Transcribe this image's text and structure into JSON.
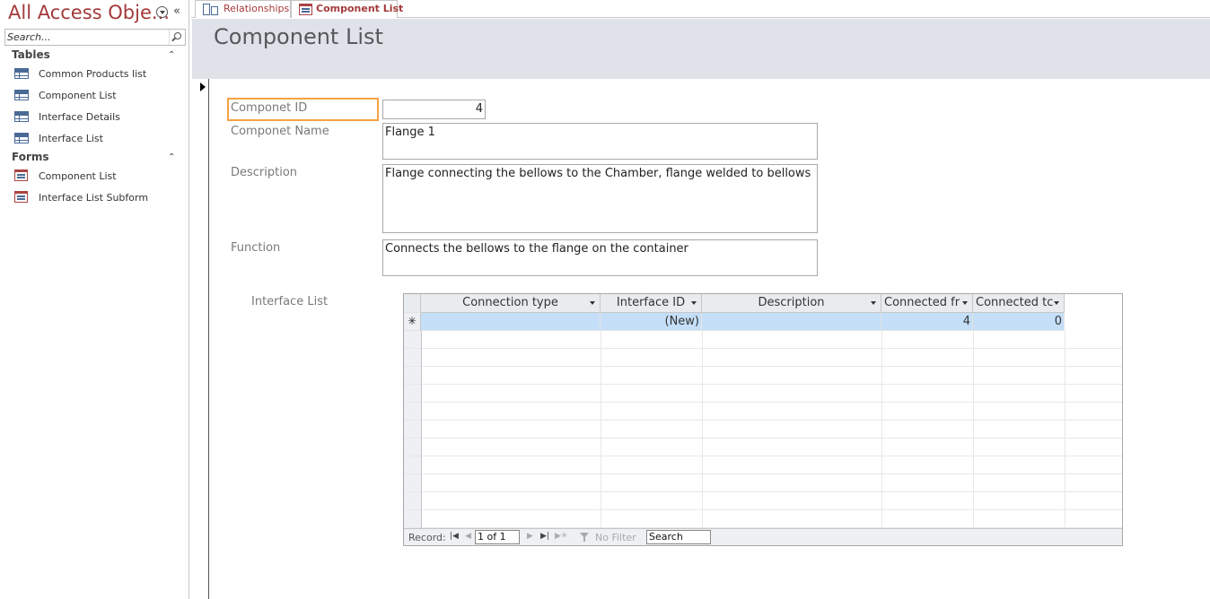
{
  "nav": {
    "title": "All Access Obje...",
    "search_placeholder": "Search...",
    "groups": [
      {
        "label": "Tables",
        "items": [
          "Common Products list",
          "Component List",
          "Interface Details",
          "Interface List"
        ]
      },
      {
        "label": "Forms",
        "items": [
          "Component List",
          "Interface List Subform"
        ]
      }
    ]
  },
  "tabs": [
    {
      "label": "Relationships",
      "icon": "relationships-icon",
      "active": false
    },
    {
      "label": "Component List",
      "icon": "form-icon",
      "active": true
    }
  ],
  "form": {
    "title": "Component List",
    "fields": {
      "id": {
        "label": "Componet ID",
        "value": "4"
      },
      "name": {
        "label": "Componet Name",
        "value": "Flange 1"
      },
      "description": {
        "label": "Description",
        "value": "Flange connecting the bellows to the Chamber, flange welded to bellows"
      },
      "function": {
        "label": "Function",
        "value": "Connects the bellows to the flange on the container"
      }
    },
    "subform": {
      "label": "Interface List",
      "columns": [
        "Connection type",
        "Interface ID",
        "Description",
        "Connected fr",
        "Connected tc"
      ],
      "new_row": {
        "connection_type": "",
        "interface_id": "(New)",
        "description": "",
        "connected_from": "4",
        "connected_to": "0"
      },
      "footer": {
        "record_label": "Record:",
        "record_position": "1 of 1",
        "filter_label": "No Filter",
        "search_value": "Search"
      }
    }
  },
  "colors": {
    "accent": "#a33a3a",
    "header_band": "#dfe3e9",
    "focus_border": "#f4a245",
    "selected_row": "#c5dff8"
  }
}
